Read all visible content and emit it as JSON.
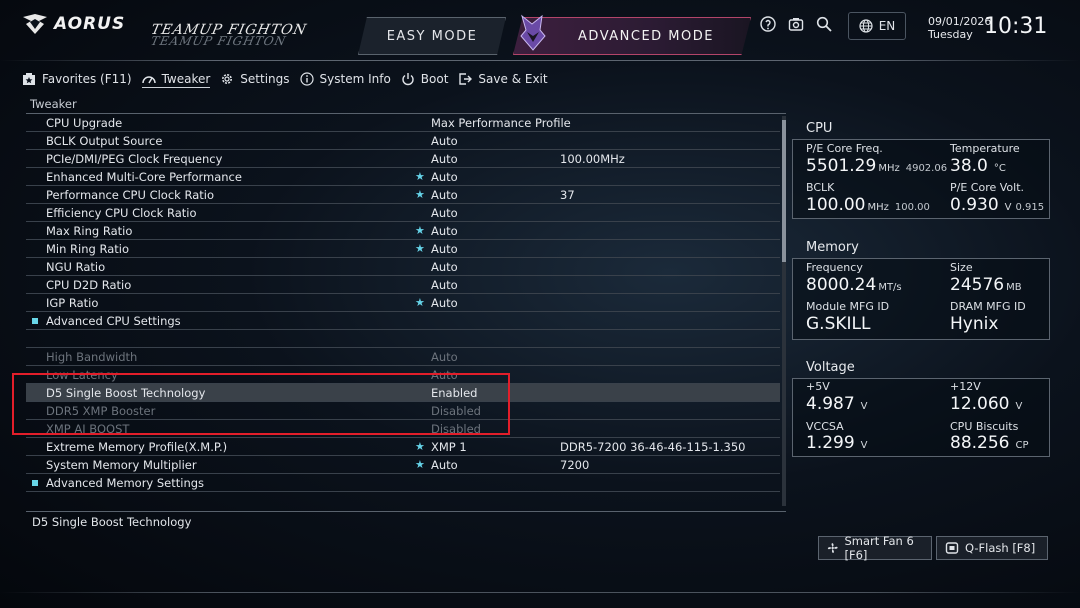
{
  "header": {
    "brand": "AORUS",
    "team_logo_top": "TEAMUP FIGHTON",
    "easy_mode": "EASY MODE",
    "advanced_mode": "ADVANCED MODE",
    "language": "EN",
    "date": "09/01/2026",
    "day": "Tuesday",
    "time": "10:31",
    "icons": [
      "help-icon",
      "screenshot-icon",
      "search-icon",
      "globe-icon"
    ]
  },
  "menu": [
    {
      "label": "Favorites (F11)",
      "icon": "favorites-icon"
    },
    {
      "label": "Tweaker",
      "icon": "tweaker-icon",
      "active": true
    },
    {
      "label": "Settings",
      "icon": "gear-icon"
    },
    {
      "label": "System Info",
      "icon": "info-icon"
    },
    {
      "label": "Boot",
      "icon": "power-icon"
    },
    {
      "label": "Save & Exit",
      "icon": "exit-icon"
    }
  ],
  "section_title": "Tweaker",
  "rows": [
    {
      "name": "CPU Upgrade",
      "star": false,
      "value": "Max Performance Profile",
      "extra": ""
    },
    {
      "name": "BCLK Output Source",
      "star": false,
      "value": "Auto",
      "extra": ""
    },
    {
      "name": "PCIe/DMI/PEG Clock Frequency",
      "star": false,
      "value": "Auto",
      "extra": "100.00MHz"
    },
    {
      "name": "Enhanced Multi-Core Performance",
      "star": true,
      "value": "Auto",
      "extra": ""
    },
    {
      "name": "Performance CPU Clock Ratio",
      "star": true,
      "value": "Auto",
      "extra": "37"
    },
    {
      "name": "Efficiency CPU Clock Ratio",
      "star": false,
      "value": "Auto",
      "extra": ""
    },
    {
      "name": "Max Ring Ratio",
      "star": true,
      "value": "Auto",
      "extra": ""
    },
    {
      "name": "Min Ring Ratio",
      "star": true,
      "value": "Auto",
      "extra": ""
    },
    {
      "name": "NGU Ratio",
      "star": false,
      "value": "Auto",
      "extra": ""
    },
    {
      "name": "CPU D2D Ratio",
      "star": false,
      "value": "Auto",
      "extra": ""
    },
    {
      "name": "IGP Ratio",
      "star": true,
      "value": "Auto",
      "extra": ""
    },
    {
      "name": "Advanced CPU Settings",
      "submenu": true
    },
    {
      "blank": true
    },
    {
      "name": "High Bandwidth",
      "star": false,
      "value": "Auto",
      "extra": "",
      "dim": true
    },
    {
      "name": "Low Latency",
      "star": false,
      "value": "Auto",
      "extra": "",
      "dim": true
    },
    {
      "name": "D5 Single Boost Technology",
      "star": false,
      "value": "Enabled",
      "extra": "",
      "selected": true
    },
    {
      "name": "DDR5 XMP Booster",
      "star": false,
      "value": "Disabled",
      "extra": "",
      "dim": true
    },
    {
      "name": "XMP AI BOOST",
      "star": false,
      "value": "Disabled",
      "extra": "",
      "dim": true
    },
    {
      "name": "Extreme Memory Profile(X.M.P.)",
      "star": true,
      "value": "XMP 1",
      "extra": "DDR5-7200 36-46-46-115-1.350"
    },
    {
      "name": "System Memory Multiplier",
      "star": true,
      "value": "Auto",
      "extra": "7200"
    },
    {
      "name": "Advanced Memory Settings",
      "submenu": true
    }
  ],
  "description": "D5 Single Boost Technology",
  "cpu": {
    "title": "CPU",
    "core_freq_label": "P/E Core Freq.",
    "core_freq_value": "5501.29",
    "core_freq_unit": "MHz",
    "core_freq_sub": "4902.06",
    "temp_label": "Temperature",
    "temp_value": "38.0",
    "temp_unit": "°C",
    "bclk_label": "BCLK",
    "bclk_value": "100.00",
    "bclk_unit": "MHz",
    "bclk_sub": "100.00",
    "volt_label": "P/E Core Volt.",
    "volt_value": "0.930",
    "volt_unit": "V",
    "volt_sub": "0.915"
  },
  "memory": {
    "title": "Memory",
    "freq_label": "Frequency",
    "freq_value": "8000.24",
    "freq_unit": "MT/s",
    "size_label": "Size",
    "size_value": "24576",
    "size_unit": "MB",
    "module_label": "Module MFG ID",
    "module_value": "G.SKILL",
    "dram_label": "DRAM MFG ID",
    "dram_value": "Hynix"
  },
  "voltage": {
    "title": "Voltage",
    "v5_label": "+5V",
    "v5_value": "4.987",
    "v5_unit": "V",
    "v12_label": "+12V",
    "v12_value": "12.060",
    "v12_unit": "V",
    "vccsa_label": "VCCSA",
    "vccsa_value": "1.299",
    "vccsa_unit": "V",
    "biscuits_label": "CPU Biscuits",
    "biscuits_value": "88.256",
    "biscuits_unit": "CP"
  },
  "bottom": {
    "smart_fan": "Smart Fan 6 [F6]",
    "qflash": "Q-Flash [F8]"
  },
  "colors": {
    "accent_cyan": "#66d3e8",
    "highlight_red": "#e31e2a",
    "advanced_mode_border": "#b3456a"
  }
}
